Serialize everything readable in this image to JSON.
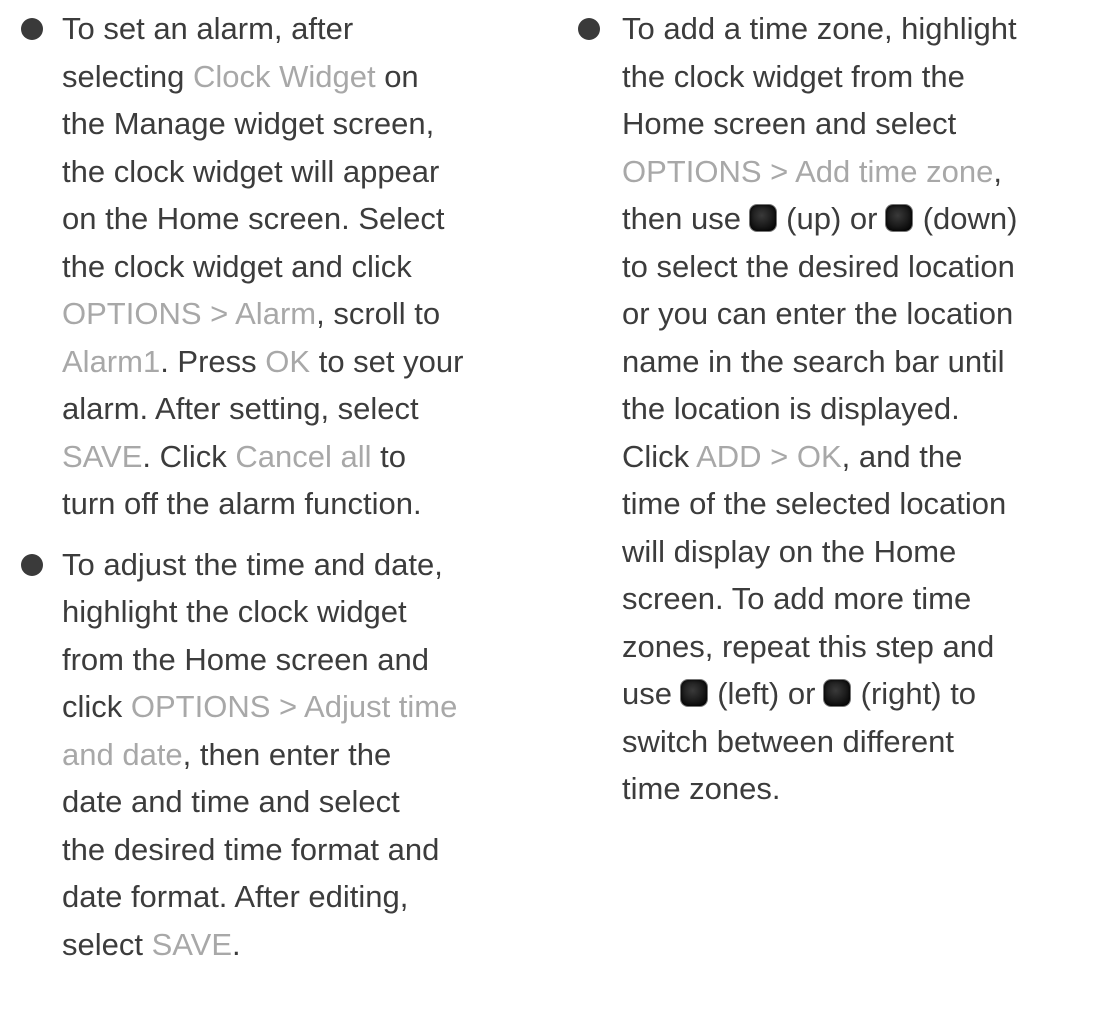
{
  "bullets_left": [
    {
      "lines": [
        [
          {
            "t": "To set an alarm, after",
            "hl": false
          }
        ],
        [
          {
            "t": "selecting ",
            "hl": false
          },
          {
            "t": "Clock Widget",
            "hl": true
          },
          {
            "t": " on",
            "hl": false
          }
        ],
        [
          {
            "t": "the Manage widget screen,",
            "hl": false
          }
        ],
        [
          {
            "t": "the clock widget will appear",
            "hl": false
          }
        ],
        [
          {
            "t": "on the Home screen. Select",
            "hl": false
          }
        ],
        [
          {
            "t": "the clock widget and click",
            "hl": false
          }
        ],
        [
          {
            "t": "OPTIONS > Alarm",
            "hl": true
          },
          {
            "t": ", scroll to",
            "hl": false
          }
        ],
        [
          {
            "t": "Alarm1",
            "hl": true
          },
          {
            "t": ". Press ",
            "hl": false
          },
          {
            "t": "OK",
            "hl": true
          },
          {
            "t": " to set your",
            "hl": false
          }
        ],
        [
          {
            "t": "alarm. After setting, select",
            "hl": false
          }
        ],
        [
          {
            "t": "SAVE",
            "hl": true
          },
          {
            "t": ". Click ",
            "hl": false
          },
          {
            "t": "Cancel all",
            "hl": true
          },
          {
            "t": " to",
            "hl": false
          }
        ],
        [
          {
            "t": "turn off the alarm function.",
            "hl": false
          }
        ]
      ]
    },
    {
      "lines": [
        [
          {
            "t": "To adjust the time and date,",
            "hl": false
          }
        ],
        [
          {
            "t": "highlight the clock widget",
            "hl": false
          }
        ],
        [
          {
            "t": "from the Home screen and",
            "hl": false
          }
        ],
        [
          {
            "t": "click ",
            "hl": false
          },
          {
            "t": "OPTIONS > Adjust time",
            "hl": true
          }
        ],
        [
          {
            "t": "and date",
            "hl": true
          },
          {
            "t": ", then enter the",
            "hl": false
          }
        ],
        [
          {
            "t": "date and time and select",
            "hl": false
          }
        ],
        [
          {
            "t": "the desired time format and",
            "hl": false
          }
        ],
        [
          {
            "t": "date format. After editing,",
            "hl": false
          }
        ],
        [
          {
            "t": "select ",
            "hl": false
          },
          {
            "t": "SAVE",
            "hl": true
          },
          {
            "t": ".",
            "hl": false
          }
        ]
      ]
    }
  ],
  "bullets_right": [
    {
      "lines": [
        [
          {
            "t": "To add a time zone, highlight",
            "hl": false
          }
        ],
        [
          {
            "t": "the clock widget from the",
            "hl": false
          }
        ],
        [
          {
            "t": "Home screen and select",
            "hl": false
          }
        ],
        [
          {
            "t": "OPTIONS > Add time zone",
            "hl": true
          },
          {
            "t": ",",
            "hl": false
          }
        ],
        [
          {
            "t": "then use ",
            "hl": false
          },
          {
            "key": "up-key-icon"
          },
          {
            "t": " (up) or ",
            "hl": false
          },
          {
            "key": "down-key-icon"
          },
          {
            "t": " (down)",
            "hl": false
          }
        ],
        [
          {
            "t": "to select the desired location",
            "hl": false
          }
        ],
        [
          {
            "t": "or you can enter the location",
            "hl": false
          }
        ],
        [
          {
            "t": "name in the search bar until",
            "hl": false
          }
        ],
        [
          {
            "t": "the location is displayed.",
            "hl": false
          }
        ],
        [
          {
            "t": "Click ",
            "hl": false
          },
          {
            "t": "ADD > OK",
            "hl": true
          },
          {
            "t": ", and the",
            "hl": false
          }
        ],
        [
          {
            "t": "time of the selected location",
            "hl": false
          }
        ],
        [
          {
            "t": "will display on the Home",
            "hl": false
          }
        ],
        [
          {
            "t": "screen. To add more time",
            "hl": false
          }
        ],
        [
          {
            "t": "zones, repeat this step and",
            "hl": false
          }
        ],
        [
          {
            "t": "use ",
            "hl": false
          },
          {
            "key": "left-key-icon"
          },
          {
            "t": " (left) or ",
            "hl": false
          },
          {
            "key": "right-key-icon"
          },
          {
            "t": " (right) to",
            "hl": false
          }
        ],
        [
          {
            "t": "switch between different",
            "hl": false
          }
        ],
        [
          {
            "t": "time zones.",
            "hl": false
          }
        ]
      ]
    }
  ],
  "colors": {
    "body_text": "#3c3c3c",
    "highlight_text": "#a8a8a8",
    "bullet": "#3a3a3a",
    "key": "#151515"
  }
}
